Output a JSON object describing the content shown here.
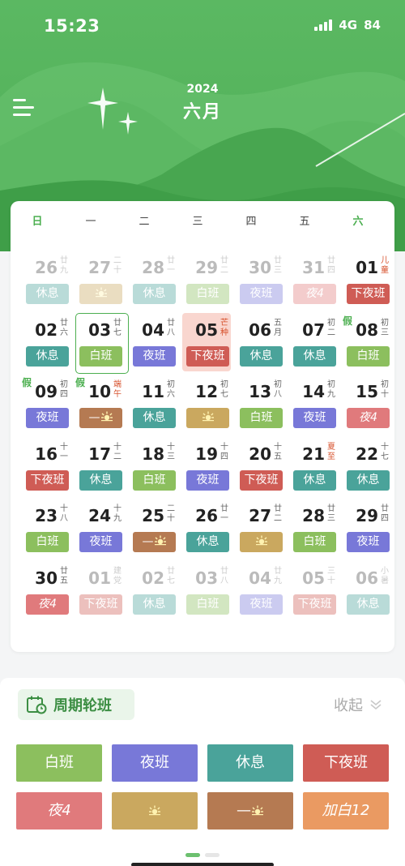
{
  "status": {
    "time": "15:23",
    "network": "4G",
    "battery": "84"
  },
  "header": {
    "year": "2024",
    "month": "六月"
  },
  "weekdays": [
    "日",
    "一",
    "二",
    "三",
    "四",
    "五",
    "六"
  ],
  "shift_colors": {
    "白班": "#8cbf5e",
    "夜班": "#7878d8",
    "休息": "#4aa39a",
    "下夜班": "#cf5c55",
    "夜4": "#e07a7c",
    "sun": "#caa85f",
    "dash_sun": "#b57a52",
    "加白12": "#ea9a62"
  },
  "calendar": [
    [
      {
        "d": "26",
        "l": "廿九",
        "s": "休息",
        "dim": true
      },
      {
        "d": "27",
        "l": "二十",
        "s": "sun",
        "dim": true
      },
      {
        "d": "28",
        "l": "廿一",
        "s": "休息",
        "dim": true
      },
      {
        "d": "29",
        "l": "廿二",
        "s": "白班",
        "dim": true
      },
      {
        "d": "30",
        "l": "廿三",
        "s": "夜班",
        "dim": true
      },
      {
        "d": "31",
        "l": "廿四",
        "s": "夜4",
        "dim": true
      },
      {
        "d": "01",
        "l": "儿童",
        "s": "下夜班",
        "red": true
      }
    ],
    [
      {
        "d": "02",
        "l": "廿六",
        "s": "休息"
      },
      {
        "d": "03",
        "l": "廿七",
        "s": "白班",
        "today": true
      },
      {
        "d": "04",
        "l": "廿八",
        "s": "夜班"
      },
      {
        "d": "05",
        "l": "芒种",
        "s": "下夜班",
        "red": true,
        "sel": true
      },
      {
        "d": "06",
        "l": "五月",
        "s": "休息"
      },
      {
        "d": "07",
        "l": "初二",
        "s": "休息"
      },
      {
        "d": "08",
        "l": "初三",
        "s": "白班",
        "holiday": "假"
      }
    ],
    [
      {
        "d": "09",
        "l": "初四",
        "s": "夜班",
        "holiday": "假"
      },
      {
        "d": "10",
        "l": "端午",
        "s": "dash_sun",
        "red": true,
        "holiday": "假"
      },
      {
        "d": "11",
        "l": "初六",
        "s": "休息"
      },
      {
        "d": "12",
        "l": "初七",
        "s": "sun"
      },
      {
        "d": "13",
        "l": "初八",
        "s": "白班"
      },
      {
        "d": "14",
        "l": "初九",
        "s": "夜班"
      },
      {
        "d": "15",
        "l": "初十",
        "s": "夜4"
      }
    ],
    [
      {
        "d": "16",
        "l": "十一",
        "s": "下夜班"
      },
      {
        "d": "17",
        "l": "十二",
        "s": "休息"
      },
      {
        "d": "18",
        "l": "十三",
        "s": "白班"
      },
      {
        "d": "19",
        "l": "十四",
        "s": "夜班"
      },
      {
        "d": "20",
        "l": "十五",
        "s": "下夜班"
      },
      {
        "d": "21",
        "l": "夏至",
        "s": "休息",
        "red": true
      },
      {
        "d": "22",
        "l": "十七",
        "s": "休息"
      }
    ],
    [
      {
        "d": "23",
        "l": "十八",
        "s": "白班"
      },
      {
        "d": "24",
        "l": "十九",
        "s": "夜班"
      },
      {
        "d": "25",
        "l": "二十",
        "s": "dash_sun"
      },
      {
        "d": "26",
        "l": "廿一",
        "s": "休息"
      },
      {
        "d": "27",
        "l": "廿二",
        "s": "sun"
      },
      {
        "d": "28",
        "l": "廿三",
        "s": "白班"
      },
      {
        "d": "29",
        "l": "廿四",
        "s": "夜班"
      }
    ],
    [
      {
        "d": "30",
        "l": "廿五",
        "s": "夜4"
      },
      {
        "d": "01",
        "l": "建党",
        "s": "下夜班",
        "dim": true
      },
      {
        "d": "02",
        "l": "廿七",
        "s": "休息",
        "dim": true
      },
      {
        "d": "03",
        "l": "廿八",
        "s": "白班",
        "dim": true
      },
      {
        "d": "04",
        "l": "廿九",
        "s": "夜班",
        "dim": true
      },
      {
        "d": "05",
        "l": "三十",
        "s": "下夜班",
        "dim": true
      },
      {
        "d": "06",
        "l": "小暑",
        "s": "休息",
        "dim": true
      }
    ]
  ],
  "panel": {
    "cycle_label": "周期轮班",
    "collapse_label": "收起",
    "buttons": [
      {
        "label": "白班",
        "key": "白班"
      },
      {
        "label": "夜班",
        "key": "夜班"
      },
      {
        "label": "休息",
        "key": "休息"
      },
      {
        "label": "下夜班",
        "key": "下夜班"
      },
      {
        "label": "夜4",
        "key": "夜4"
      },
      {
        "label": "",
        "key": "sun",
        "icon": "sun-icon"
      },
      {
        "label": "—",
        "key": "dash_sun",
        "icon": "sun-icon"
      },
      {
        "label": "加白12",
        "key": "加白12"
      }
    ]
  }
}
